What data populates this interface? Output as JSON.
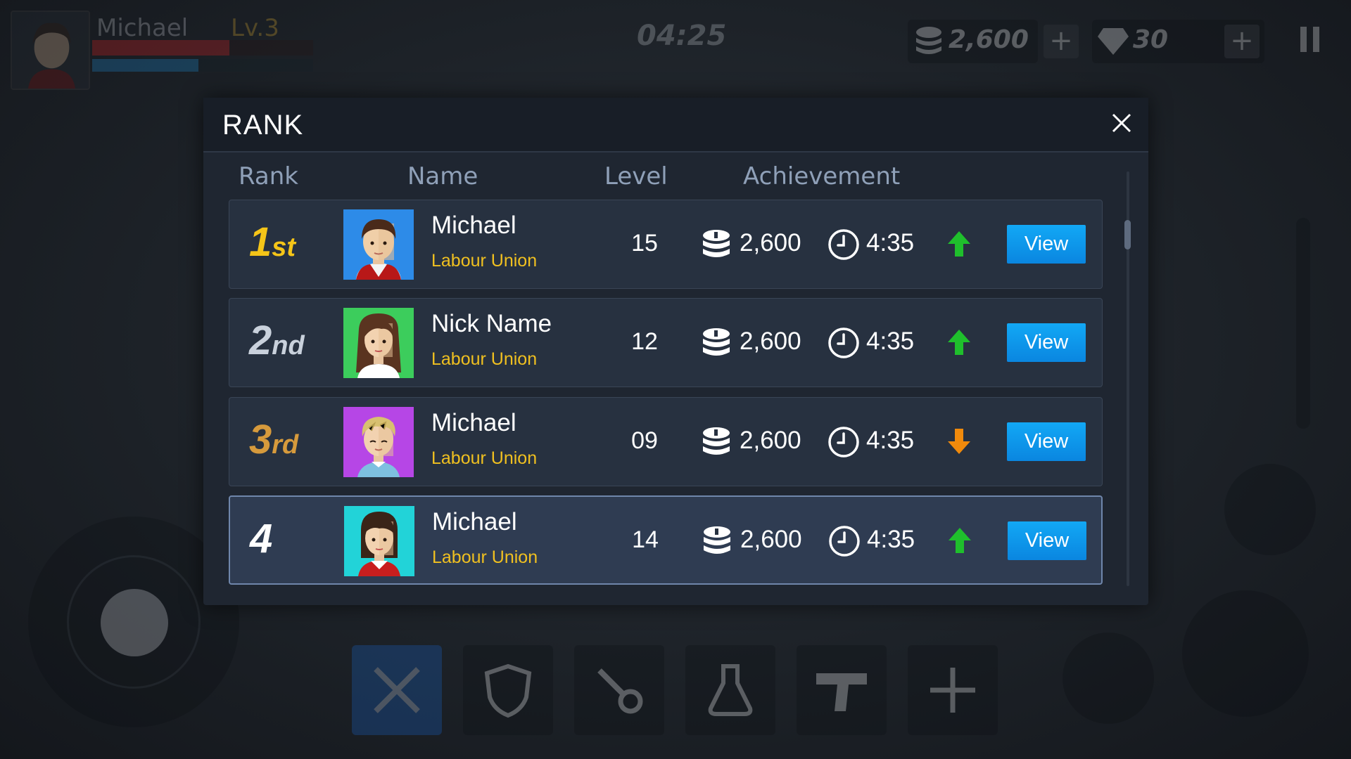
{
  "hud": {
    "player_name": "Michael",
    "level": "Lv.3",
    "timer": "04:25",
    "coins": "2,600",
    "gems": "30",
    "hp_fraction": 0.62,
    "mp_fraction": 0.48
  },
  "dialog": {
    "title": "RANK",
    "columns": {
      "rank": "Rank",
      "name": "Name",
      "level": "Level",
      "achievement": "Achievement"
    },
    "view_label": "View",
    "rows": [
      {
        "rank": "1",
        "suffix": "st",
        "name": "Michael",
        "guild": "Labour Union",
        "level": "15",
        "coins": "2,600",
        "time": "4:35",
        "trend": "up",
        "rank_color": "#f5c518",
        "avatar_bg": "#2d8be8"
      },
      {
        "rank": "2",
        "suffix": "nd",
        "name": "Nick Name",
        "guild": "Labour Union",
        "level": "12",
        "coins": "2,600",
        "time": "4:35",
        "trend": "up",
        "rank_color": "#c9d1dc",
        "avatar_bg": "#3ccd5c"
      },
      {
        "rank": "3",
        "suffix": "rd",
        "name": "Michael",
        "guild": "Labour Union",
        "level": "09",
        "coins": "2,600",
        "time": "4:35",
        "trend": "down",
        "rank_color": "#d69a3c",
        "avatar_bg": "#b646e6"
      },
      {
        "rank": "4",
        "suffix": "",
        "name": "Michael",
        "guild": "Labour Union",
        "level": "14",
        "coins": "2,600",
        "time": "4:35",
        "trend": "up",
        "rank_color": "#ffffff",
        "avatar_bg": "#22d3d8"
      }
    ]
  },
  "colors": {
    "trend_up": "#1fbf2c",
    "trend_down": "#f08a0c",
    "guild": "#f0c020",
    "view_button": "#0f9aee"
  }
}
